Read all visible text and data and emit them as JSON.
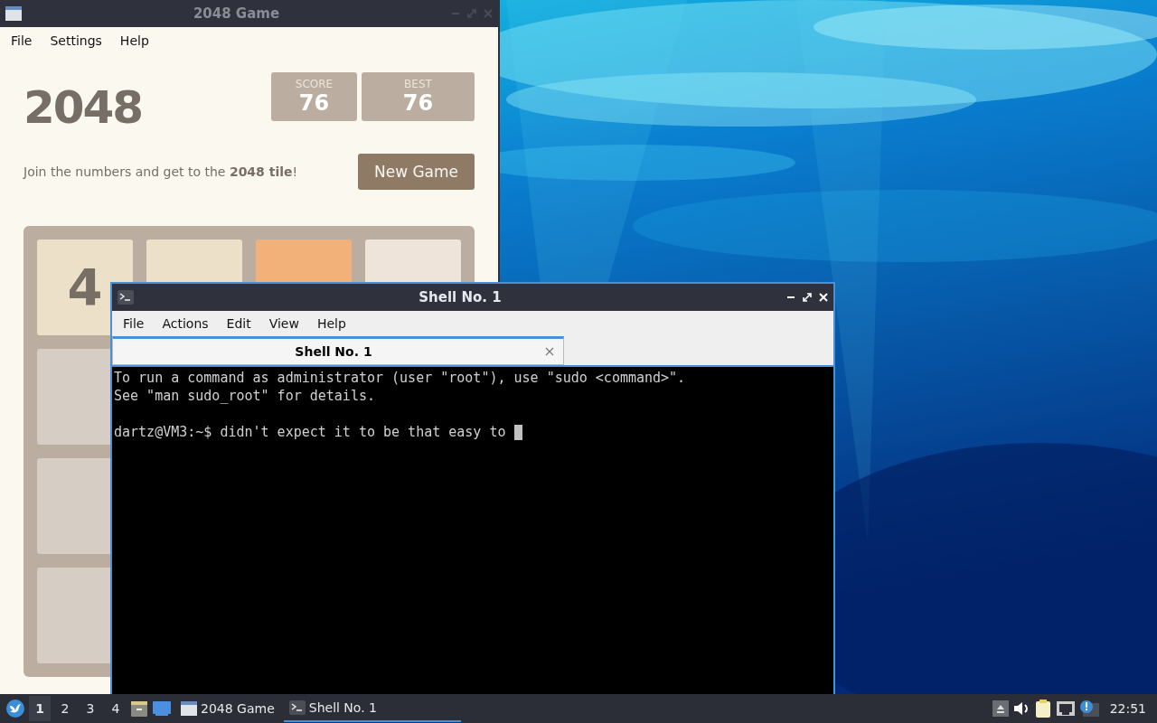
{
  "game_window": {
    "title": "2048 Game",
    "menu": [
      "File",
      "Settings",
      "Help"
    ],
    "heading": "2048",
    "scores": [
      {
        "label": "SCORE",
        "value": "76"
      },
      {
        "label": "BEST",
        "value": "76"
      }
    ],
    "intro": "Join the numbers and get to the **2048 tile**!",
    "new_game_button": "New Game",
    "board": [
      [
        {
          "value": "4",
          "color": "#ede0c8"
        },
        {
          "color": "#ede0c8"
        },
        {
          "color": "#f2b179"
        },
        {
          "color": "#eee4da"
        }
      ],
      [
        {
          "color": "#d6cdc4"
        }
      ],
      [
        {
          "color": "#d6cdc4"
        }
      ],
      [
        {
          "color": "#d6cdc4"
        }
      ]
    ]
  },
  "terminal_window": {
    "title": "Shell No. 1",
    "menu": [
      "File",
      "Actions",
      "Edit",
      "View",
      "Help"
    ],
    "tabs": [
      {
        "label": "Shell No. 1",
        "selected": true
      }
    ],
    "message_lines": [
      "To run a command as administrator (user \"root\"), use \"sudo <command>\".",
      "See \"man sudo_root\" for details."
    ],
    "prompt_line": "dartz@VM3:~$ didn't expect it to be that easy to "
  },
  "taskbar": {
    "desktops": [
      {
        "label": "1",
        "selected": true
      },
      {
        "label": "2",
        "selected": false
      },
      {
        "label": "3",
        "selected": false
      },
      {
        "label": "4",
        "selected": false
      }
    ],
    "tasks": [
      {
        "label": "2048 Game",
        "kind": "window",
        "selected": false
      },
      {
        "label": "Shell No. 1",
        "kind": "terminal",
        "selected": true
      }
    ],
    "clock": "22:51"
  }
}
